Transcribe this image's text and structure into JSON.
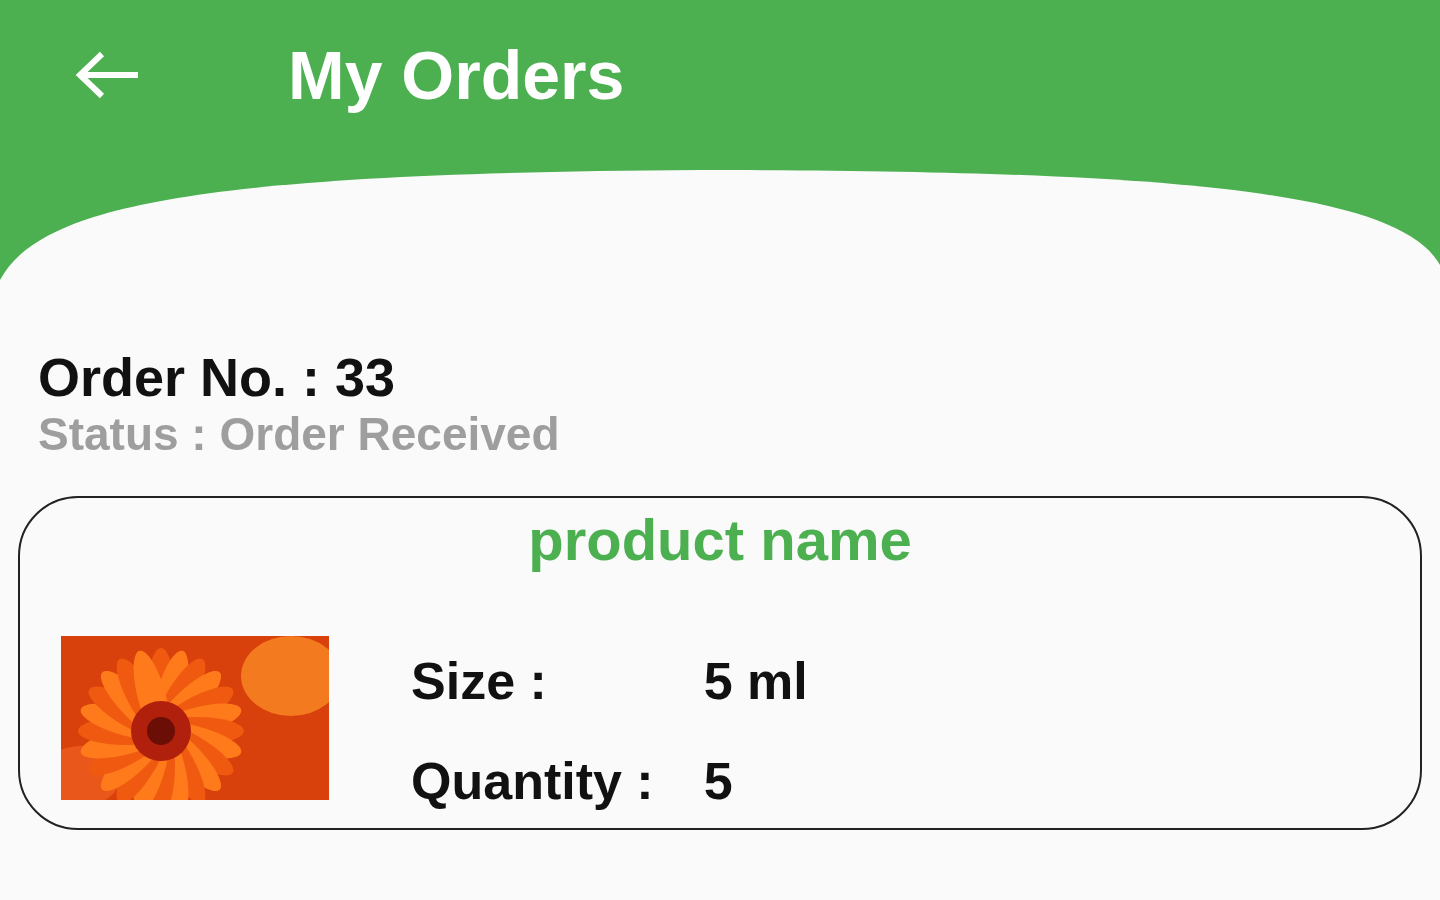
{
  "header": {
    "title": "My Orders"
  },
  "order": {
    "number": "Order No. : 33",
    "status": "Status : Order Received"
  },
  "item": {
    "product_name": "product name",
    "size_label": "Size :",
    "size_value": "5 ml",
    "quantity_label": "Quantity :",
    "quantity_value": "5"
  }
}
